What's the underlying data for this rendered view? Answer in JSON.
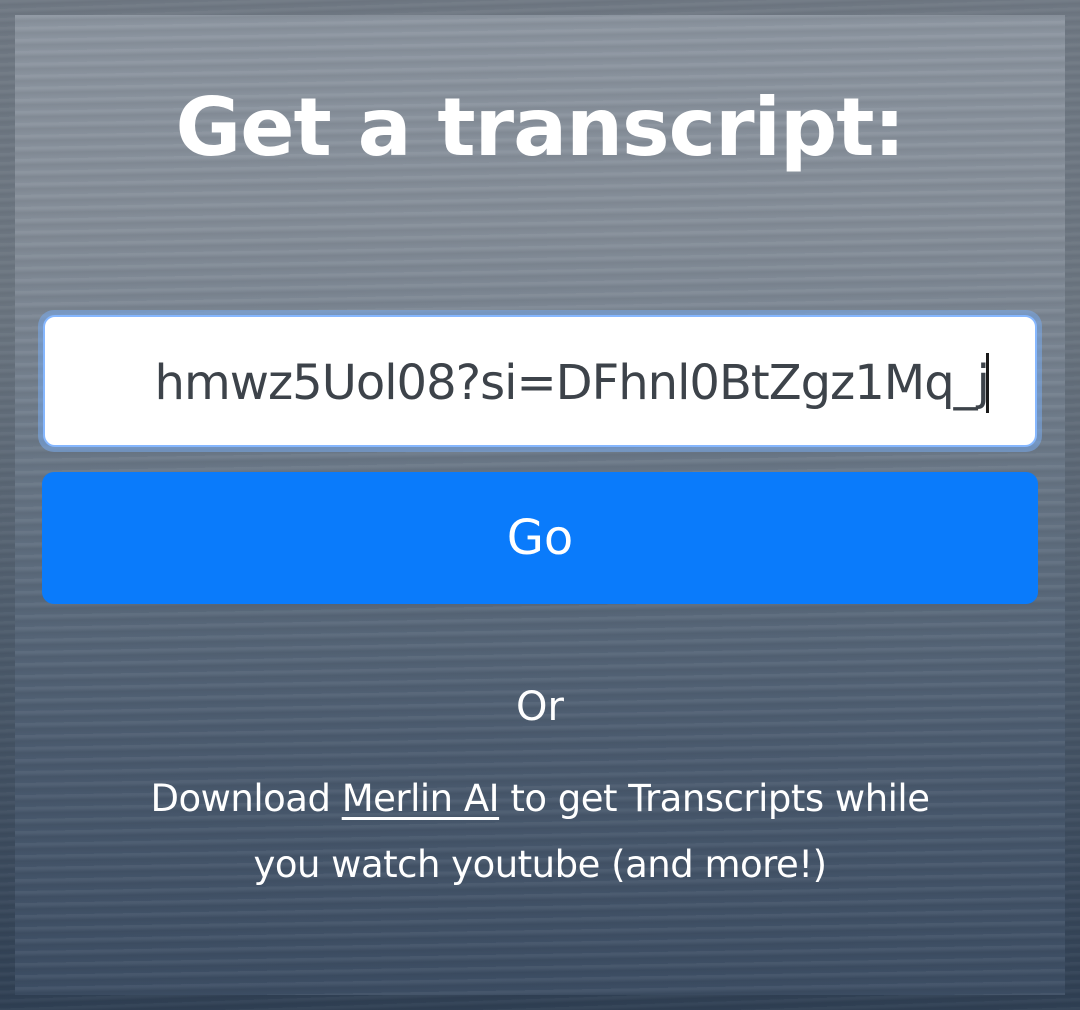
{
  "page": {
    "title": "Get a transcript:"
  },
  "form": {
    "url_input_value": "hmwz5Uol08?si=DFhnl0BtZgz1Mq_j",
    "go_label": "Go"
  },
  "divider": {
    "or_text": "Or"
  },
  "promo": {
    "prefix": "Download ",
    "link_text": "Merlin AI",
    "line1_suffix": " to get Transcripts while",
    "line2": "you watch youtube (and more!)"
  },
  "colors": {
    "button": "#0a7bfb",
    "text_on_bg": "#ffffff",
    "input_focus_border": "#86b7fe"
  }
}
